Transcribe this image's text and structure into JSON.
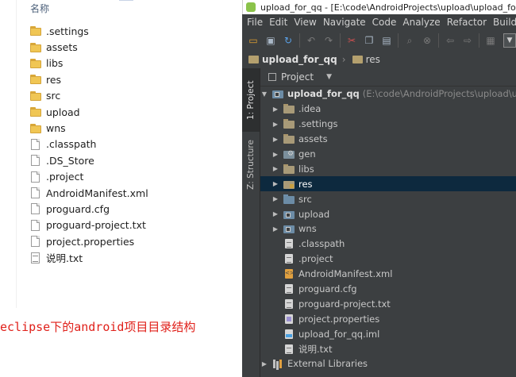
{
  "explorer": {
    "column_header": "名称",
    "items": [
      {
        "name": ".settings",
        "type": "folder"
      },
      {
        "name": "assets",
        "type": "folder"
      },
      {
        "name": "libs",
        "type": "folder"
      },
      {
        "name": "res",
        "type": "folder"
      },
      {
        "name": "src",
        "type": "folder"
      },
      {
        "name": "upload",
        "type": "folder"
      },
      {
        "name": "wns",
        "type": "folder"
      },
      {
        "name": ".classpath",
        "type": "file"
      },
      {
        "name": ".DS_Store",
        "type": "file"
      },
      {
        "name": ".project",
        "type": "file"
      },
      {
        "name": "AndroidManifest.xml",
        "type": "file"
      },
      {
        "name": "proguard.cfg",
        "type": "file"
      },
      {
        "name": "proguard-project.txt",
        "type": "file"
      },
      {
        "name": "project.properties",
        "type": "file"
      },
      {
        "name": "说明.txt",
        "type": "textfile"
      }
    ],
    "caption": "eclipse下的android项目目录结构",
    "caption_color": "#e0201a"
  },
  "ide": {
    "window_title": "upload_for_qq - [E:\\code\\AndroidProjects\\upload\\upload_for_q",
    "menu": [
      "File",
      "Edit",
      "View",
      "Navigate",
      "Code",
      "Analyze",
      "Refactor",
      "Build"
    ],
    "toolbar_icons": [
      "folder-open-icon",
      "save-icon",
      "sync-icon",
      "undo-icon",
      "redo-icon",
      "cut-icon",
      "copy-icon",
      "paste-icon",
      "find-icon",
      "replace-icon",
      "back-icon",
      "forward-icon",
      "build-icon",
      "run-config-dropdown"
    ],
    "breadcrumb": [
      "upload_for_qq",
      "res"
    ],
    "side_tabs": {
      "project": "1: Project",
      "structure": "Z: Structure"
    },
    "panel_title": "Project",
    "tree_root": {
      "name": "upload_for_qq",
      "path": "(E:\\code\\AndroidProjects\\upload\\uploa"
    },
    "tree": [
      {
        "name": ".idea",
        "icon": "folder",
        "expandable": true
      },
      {
        "name": ".settings",
        "icon": "folder",
        "expandable": true
      },
      {
        "name": "assets",
        "icon": "folder",
        "expandable": true
      },
      {
        "name": "gen",
        "icon": "folder-gen",
        "expandable": true
      },
      {
        "name": "libs",
        "icon": "folder",
        "expandable": true
      },
      {
        "name": "res",
        "icon": "folder-res",
        "expandable": true,
        "selected": true
      },
      {
        "name": "src",
        "icon": "folder-blue",
        "expandable": true
      },
      {
        "name": "upload",
        "icon": "module",
        "expandable": true
      },
      {
        "name": "wns",
        "icon": "module",
        "expandable": true
      },
      {
        "name": ".classpath",
        "icon": "file",
        "expandable": false
      },
      {
        "name": ".project",
        "icon": "file",
        "expandable": false
      },
      {
        "name": "AndroidManifest.xml",
        "icon": "xml",
        "expandable": false
      },
      {
        "name": "proguard.cfg",
        "icon": "file",
        "expandable": false
      },
      {
        "name": "proguard-project.txt",
        "icon": "file",
        "expandable": false
      },
      {
        "name": "project.properties",
        "icon": "props",
        "expandable": false
      },
      {
        "name": "upload_for_qq.iml",
        "icon": "iml",
        "expandable": false
      },
      {
        "name": "说明.txt",
        "icon": "file",
        "expandable": false
      }
    ],
    "external_libraries": "External Libraries",
    "selection_color": "#0d293e",
    "background_color": "#3c3f41"
  }
}
